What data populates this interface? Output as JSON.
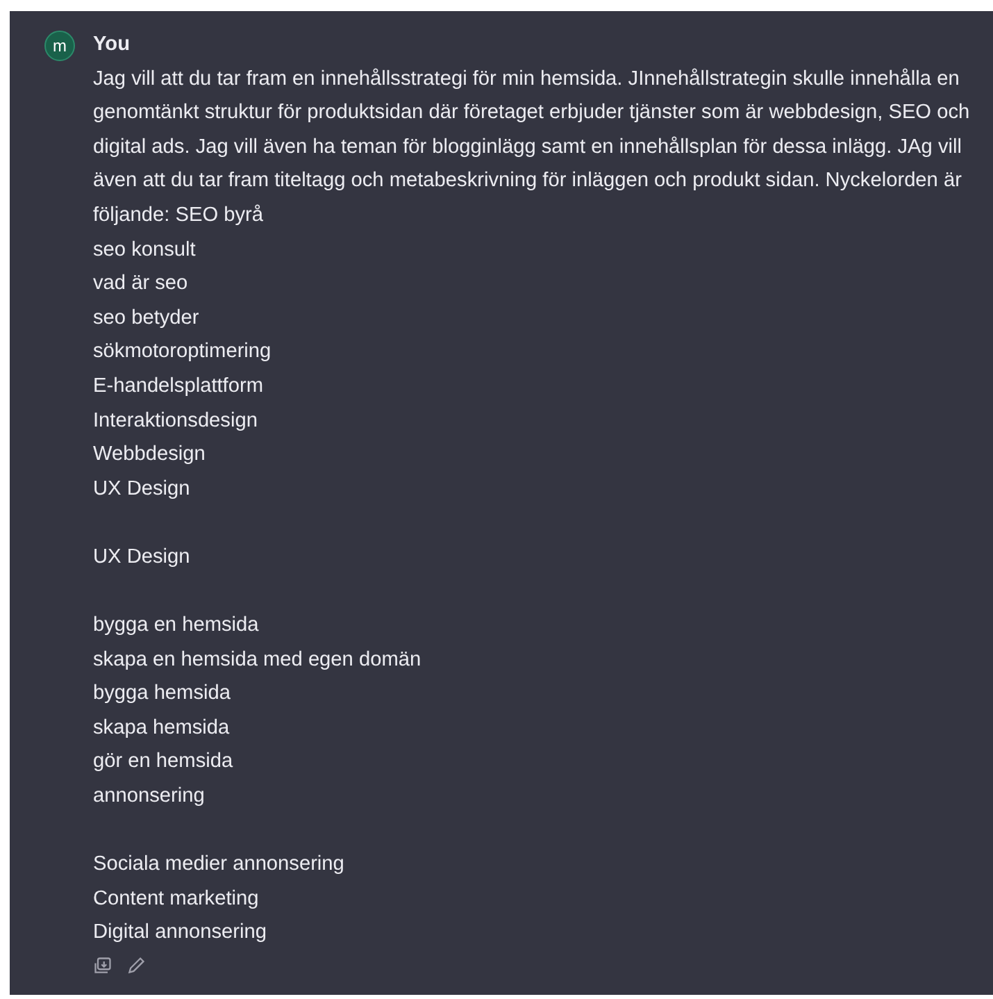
{
  "message": {
    "avatar": "m",
    "author": "You",
    "paragraph": "Jag vill att du tar fram en innehållsstrategi för min hemsida. JInnehållstrategin skulle innehålla en genomtänkt struktur för produktsidan där företaget erbjuder tjänster som är webbdesign, SEO och digital ads. Jag vill även ha teman för blogginlägg samt en innehållsplan för dessa inlägg. JAg vill även att du tar fram titeltagg och metabeskrivning för inläggen och produkt sidan. Nyckelorden är följande: SEO byrå",
    "line_groups": [
      [
        "seo konsult",
        "vad är seo",
        "seo betyder",
        "sökmotoroptimering",
        "E-handelsplattform",
        "Interaktionsdesign",
        "Webbdesign",
        "UX Design"
      ],
      [
        "UX Design"
      ],
      [
        "bygga en hemsida",
        "skapa en hemsida med egen domän",
        "bygga hemsida",
        "skapa hemsida",
        "gör en hemsida",
        "annonsering"
      ],
      [
        "Sociala medier annonsering",
        "Content marketing",
        "Digital annonsering"
      ]
    ]
  }
}
